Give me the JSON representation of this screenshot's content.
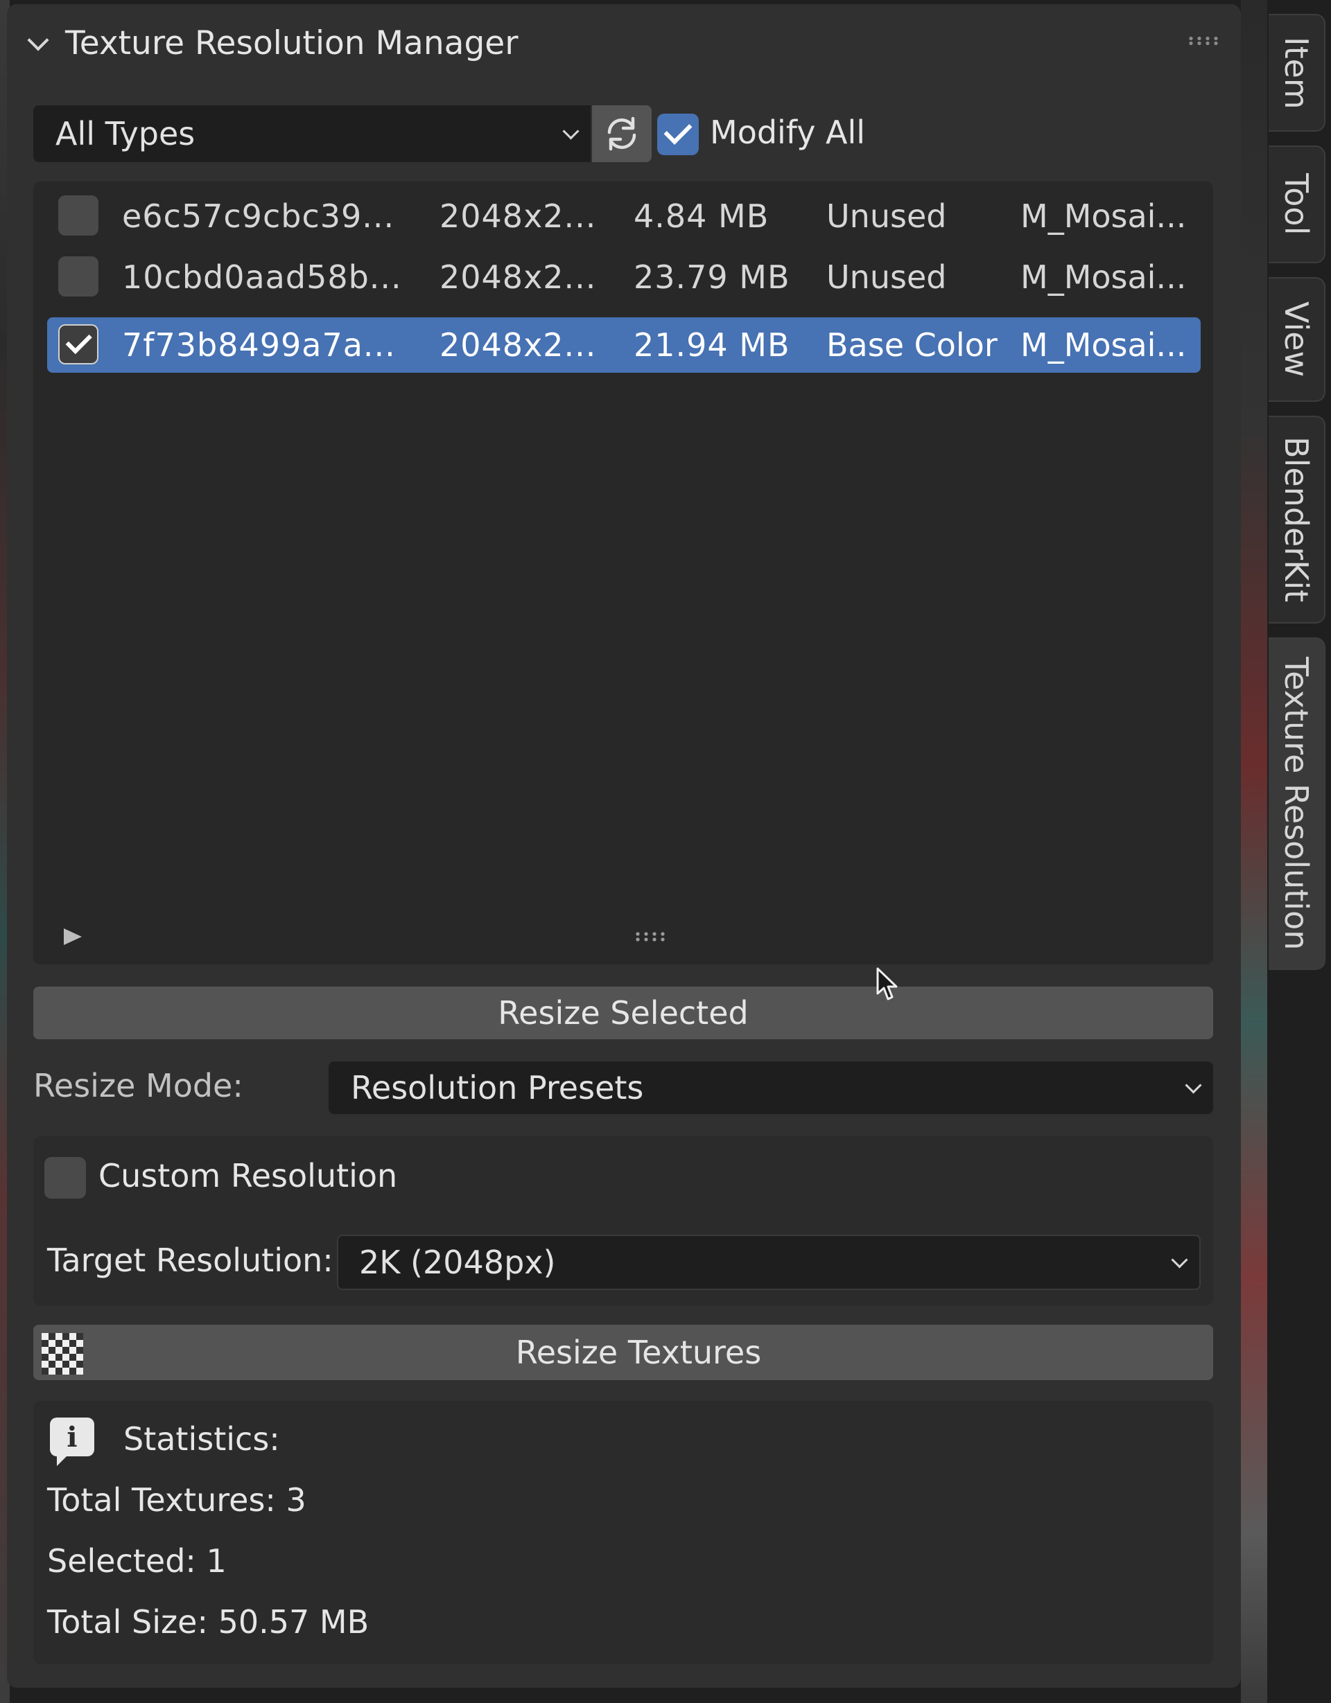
{
  "panel": {
    "title": "Texture Resolution Manager"
  },
  "toolbar": {
    "filter_value": "All Types",
    "modify_all_label": "Modify All",
    "modify_all_checked": true
  },
  "texture_list": {
    "rows": [
      {
        "name": "e6c57c9cbc39...",
        "resolution": "2048x2...",
        "size": "4.84 MB",
        "usage": "Unused",
        "material": "M_Mosai...",
        "checked": false,
        "selected": false
      },
      {
        "name": "10cbd0aad58b...",
        "resolution": "2048x2...",
        "size": "23.79 MB",
        "usage": "Unused",
        "material": "M_Mosai...",
        "checked": false,
        "selected": false
      },
      {
        "name": "7f73b8499a7a...",
        "resolution": "2048x2...",
        "size": "21.94 MB",
        "usage": "Base Color",
        "material": "M_Mosai...",
        "checked": true,
        "selected": true
      }
    ]
  },
  "actions": {
    "resize_selected": "Resize Selected",
    "resize_mode_label": "Resize Mode:",
    "resize_mode_value": "Resolution Presets",
    "custom_resolution_label": "Custom Resolution",
    "custom_resolution_checked": false,
    "target_resolution_label": "Target Resolution:",
    "target_resolution_value": "2K (2048px)",
    "resize_textures": "Resize Textures"
  },
  "statistics": {
    "heading": "Statistics:",
    "total_textures": "Total Textures: 3",
    "selected": "Selected: 1",
    "total_size": "Total Size: 50.57 MB"
  },
  "sidebar_tabs": [
    "Item",
    "Tool",
    "View",
    "BlenderKit",
    "Texture Resolution"
  ],
  "colors": {
    "accent": "#4772b3",
    "panel_bg": "#303030",
    "field_bg": "#1e1e1e",
    "button_bg": "#545454"
  }
}
